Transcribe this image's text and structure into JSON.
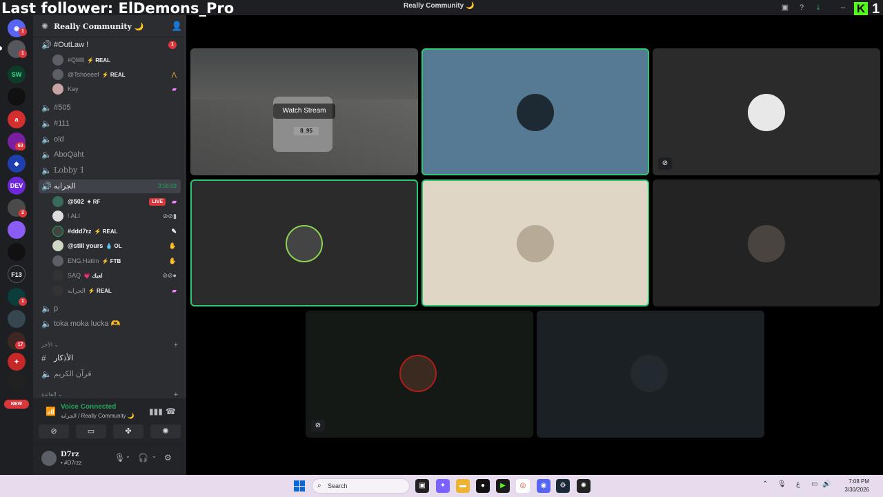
{
  "overlay": {
    "follower_text": "Last follower: ElDemons_Pro",
    "kick_count": "1"
  },
  "titlebar": {
    "title": "Really Community 🌙"
  },
  "rail": {
    "badges": [
      "1",
      "1",
      "60",
      "2",
      "1",
      "17"
    ],
    "new_label": "NEW"
  },
  "server": {
    "name": "Really Community 🌙"
  },
  "channels": [
    {
      "name": "#OutLaw !",
      "badge": "1"
    },
    {
      "name": "#505"
    },
    {
      "name": "#111"
    },
    {
      "name": "old"
    },
    {
      "name": "AboQaht"
    },
    {
      "name": "Lobby 1"
    },
    {
      "name": "الجرابه",
      "timer": "3:56:09"
    },
    {
      "name": "p"
    },
    {
      "name": "toka moka lucka 🫶"
    }
  ],
  "outlaw_users": [
    {
      "name": "#Qlillll",
      "tag": "⚡ REAL"
    },
    {
      "name": "@Tshóeeef",
      "tag": "⚡ REAL"
    },
    {
      "name": "Kay",
      "tag": ""
    }
  ],
  "voice_users": [
    {
      "name": "@502",
      "tag": "✦ RF",
      "live": "LIVE"
    },
    {
      "name": "! ALI",
      "tag": ""
    },
    {
      "name": "#ddd7rz",
      "tag": "⚡ REAL"
    },
    {
      "name": "@still yours",
      "tag": "💧 OL"
    },
    {
      "name": "ENG.Hatim",
      "tag": "⚡ FTB"
    },
    {
      "name": "SAQ",
      "tag": "💗 لعبك"
    },
    {
      "name": "الجرابه",
      "tag": "⚡ REAL"
    }
  ],
  "categories": [
    {
      "name": "الأجر ⌄"
    },
    {
      "name": "الفائدة ⌄"
    }
  ],
  "text_channels": [
    {
      "name": "الأذكار"
    },
    {
      "name": "قرآن الكريم"
    }
  ],
  "voice_panel": {
    "status": "Voice Connected",
    "location": "الجرابه / Really Community 🌙"
  },
  "user_panel": {
    "name": "D7rz",
    "handle": "• #D7rzz"
  },
  "stage": {
    "watch_label": "Watch Stream",
    "plate_text": "8_95"
  },
  "taskbar": {
    "search_placeholder": "Search",
    "time": "7:08 PM",
    "date": "3/30/2026"
  },
  "colors": {
    "speaking": "#2dc770",
    "voice_green": "#23a55a",
    "live_red": "#da373c",
    "kick_green": "#53fc18"
  },
  "icons": [
    "discord-icon",
    "speaker-icon",
    "gear-icon",
    "invite-icon",
    "mic-icon",
    "headphones-icon",
    "settings-icon",
    "mute-icon",
    "search-icon"
  ]
}
